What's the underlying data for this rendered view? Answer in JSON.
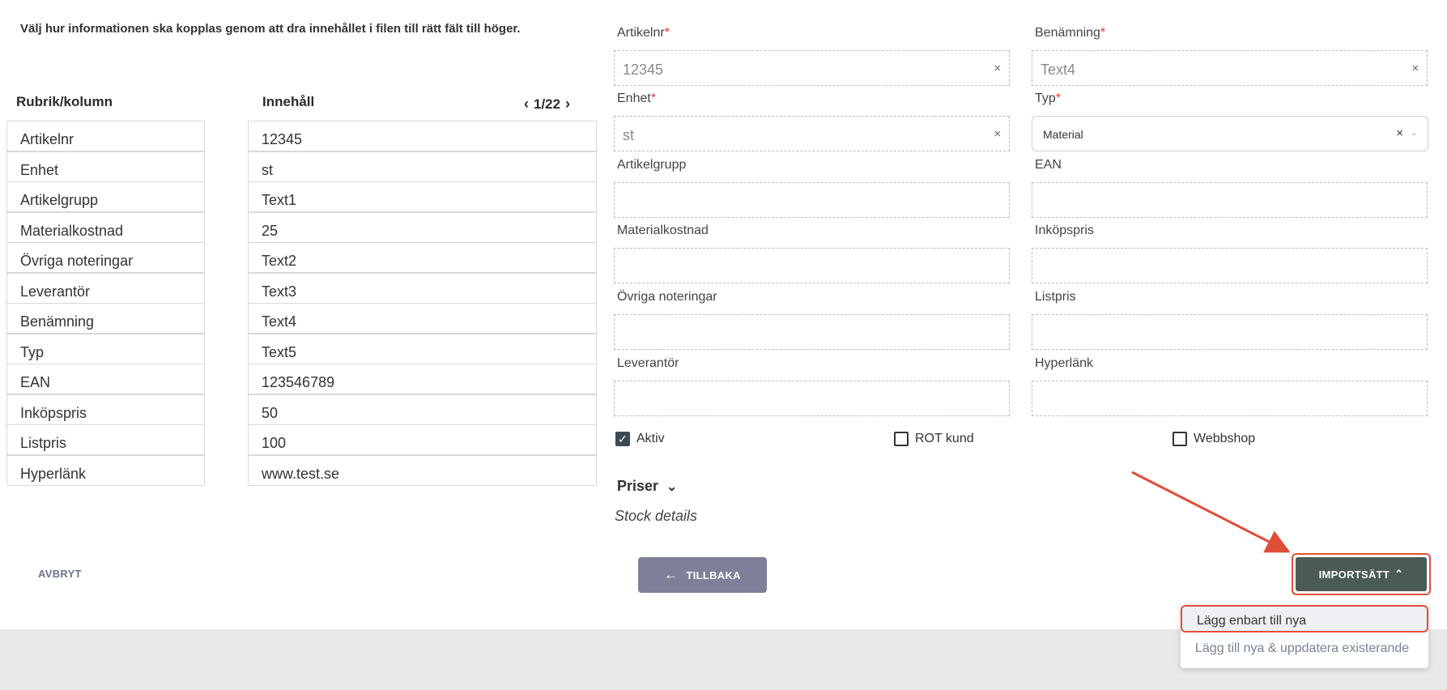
{
  "instruction": "Välj hur informationen ska kopplas genom att dra innehållet i filen till rätt fält till höger.",
  "columns": {
    "left_header": "Rubrik/kolumn",
    "right_header": "Innehåll",
    "pager": "1/22"
  },
  "rows": [
    {
      "key": "Artikelnr",
      "value": "12345"
    },
    {
      "key": "Enhet",
      "value": "st"
    },
    {
      "key": "Artikelgrupp",
      "value": "Text1"
    },
    {
      "key": "Materialkostnad",
      "value": "25"
    },
    {
      "key": "Övriga noteringar",
      "value": "Text2"
    },
    {
      "key": "Leverantör",
      "value": "Text3"
    },
    {
      "key": "Benämning",
      "value": "Text4"
    },
    {
      "key": "Typ",
      "value": "Text5"
    },
    {
      "key": "EAN",
      "value": "123546789"
    },
    {
      "key": "Inköpspris",
      "value": "50"
    },
    {
      "key": "Listpris",
      "value": "100"
    },
    {
      "key": "Hyperlänk",
      "value": "www.test.se"
    }
  ],
  "form": {
    "artikelnr": {
      "label": "Artikelnr",
      "value": "12345"
    },
    "benamning": {
      "label": "Benämning",
      "value": "Text4"
    },
    "enhet": {
      "label": "Enhet",
      "value": "st"
    },
    "typ": {
      "label": "Typ",
      "value": "Material"
    },
    "artikelgrupp": {
      "label": "Artikelgrupp",
      "value": ""
    },
    "ean": {
      "label": "EAN",
      "value": ""
    },
    "materialkostnad": {
      "label": "Materialkostnad",
      "value": ""
    },
    "inkopspris": {
      "label": "Inköpspris",
      "value": ""
    },
    "ovriga": {
      "label": "Övriga noteringar",
      "value": ""
    },
    "listpris": {
      "label": "Listpris",
      "value": ""
    },
    "leverantor": {
      "label": "Leverantör",
      "value": ""
    },
    "hyperlank": {
      "label": "Hyperlänk",
      "value": ""
    },
    "required_mark": "*",
    "clear_glyph": "×"
  },
  "checkboxes": [
    {
      "label": "Aktiv",
      "checked": true
    },
    {
      "label": "ROT kund",
      "checked": false
    },
    {
      "label": "Webbshop",
      "checked": false
    }
  ],
  "sections": {
    "priser": "Priser",
    "stock": "Stock details"
  },
  "buttons": {
    "cancel": "AVBRYT",
    "back": "TILLBAKA",
    "import": "IMPORTSÄTT"
  },
  "dropdown": [
    "Lägg enbart till nya",
    "Lägg till nya & uppdatera existerande"
  ],
  "colors": {
    "annotation": "#e04e3a",
    "import_button": "#4b5a55",
    "back_button": "#7d8098",
    "checkbox_checked": "#3a4a56"
  }
}
